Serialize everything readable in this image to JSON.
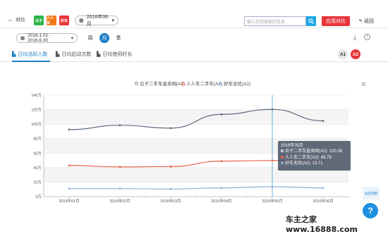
{
  "topbar": {
    "compare_label": "对比",
    "apps": [
      {
        "label": "瓜子",
        "color": "#2db34a"
      },
      {
        "label": "人人车",
        "color": "#f27a1b"
      },
      {
        "label": "好车",
        "color": "#e8353a"
      }
    ],
    "month_value": "2016年06月",
    "search_placeholder": "输入您想搜索的信息",
    "apply_label": "应用对比",
    "back_label": "返回"
  },
  "datebar": {
    "range_value": "2016.1.01 - 2016.6.30",
    "periods": [
      "周",
      "月",
      "季"
    ],
    "active_period": "月"
  },
  "tabs": [
    {
      "label": "日均活跃人数",
      "active": true
    },
    {
      "label": "日均启动次数",
      "active": false
    },
    {
      "label": "日均使用时长",
      "active": false
    }
  ],
  "badges": {
    "a1": "A1",
    "a2": "A2"
  },
  "chart_data": {
    "type": "line",
    "categories": [
      "2016年01月",
      "2016年02月",
      "2016年03月",
      "2016年04月",
      "2016年05月",
      "2016年06月"
    ],
    "yticks": [
      "0万",
      "20万",
      "40万",
      "60万",
      "80万",
      "100万",
      "120万",
      "140万"
    ],
    "ylim": [
      0,
      140
    ],
    "series": [
      {
        "name": "瓜子二手车直卖网(A2)",
        "color": "#5d6c80",
        "values": [
          92.5,
          98.5,
          94.5,
          113.5,
          120.36,
          104.5
        ]
      },
      {
        "name": "人人车二手车(A2)",
        "color": "#e8604a",
        "values": [
          43,
          41,
          41.5,
          49,
          49.79,
          49
        ]
      },
      {
        "name": "好车无忧(A2)",
        "color": "#8ab0d0",
        "values": [
          11,
          11,
          10.5,
          12,
          13.71,
          12
        ]
      }
    ],
    "tooltip": {
      "title": "2016年05月",
      "rows": [
        {
          "label": "瓜子二手车直卖网(A2)",
          "value": "120.36"
        },
        {
          "label": "人人车二手车(A2)",
          "value": "49.79"
        },
        {
          "label": "好车无忧(A2)",
          "value": "13.71"
        }
      ]
    },
    "grid": true,
    "legend_position": "top-center"
  },
  "side": {
    "button_label": "返回顶部",
    "help_label": "?"
  },
  "watermark": "车主之家 www.16888.com"
}
